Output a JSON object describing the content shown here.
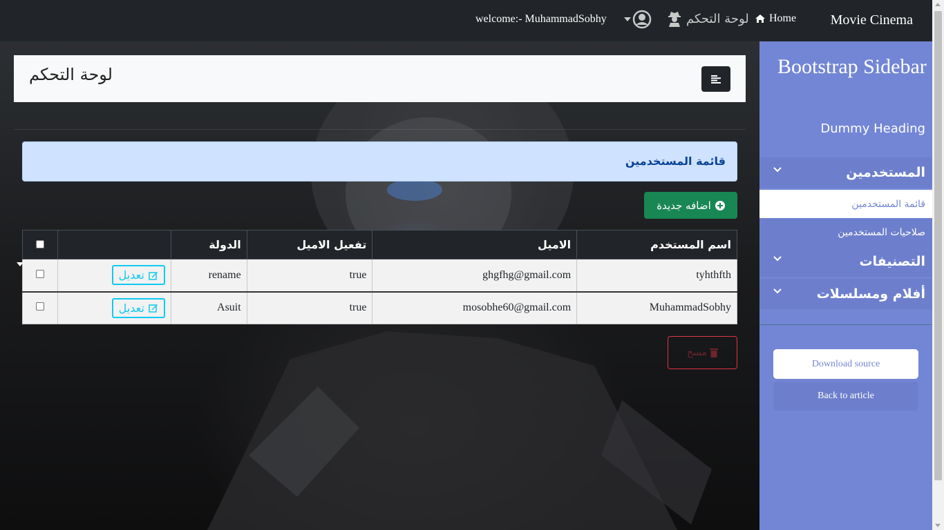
{
  "navbar": {
    "brand": "Movie Cinema",
    "home_label": "Home",
    "dashboard_label": "لوحة التحكم",
    "welcome_text": "welcome:- MuhammadSobhy",
    "icons": {
      "home": "home-icon",
      "dashboard": "user-secret-icon",
      "user": "user-circle-icon",
      "dropdown": "caret-down-icon"
    }
  },
  "page_header": {
    "title": "لوحة التحكم",
    "toggle_icon": "align-left-icon"
  },
  "alert": {
    "text": "قائمة المستخدمين"
  },
  "add_button": {
    "label": "اضافه جديدة",
    "icon": "plus-circle-icon"
  },
  "table": {
    "headers": {
      "username": "اسم المستخدم",
      "email": "الاميل",
      "activation": "تفعيل الاميل",
      "country": "الدولة",
      "actions": ""
    },
    "rows": [
      {
        "username": "tyhthfth",
        "email": "ghgfhg@gmail.com",
        "activation": "true",
        "country": "rename",
        "edit_label": "تعديل"
      },
      {
        "username": "MuhammadSobhy",
        "email": "mosobhe60@gmail.com",
        "activation": "true",
        "country": "Asuit",
        "edit_label": "تعديل"
      }
    ]
  },
  "delete_button": {
    "label": "مسح",
    "icon": "trash-icon"
  },
  "sidebar": {
    "title": "Bootstrap Sidebar",
    "heading": "Dummy Heading",
    "items": [
      {
        "label": "المستخدمين",
        "expanded": true
      },
      {
        "label": "التصنيفات",
        "expanded": false
      },
      {
        "label": "أفلام ومسلسلات",
        "expanded": false
      }
    ],
    "subitems": [
      {
        "label": "قائمة المستخدمين",
        "selected": true
      },
      {
        "label": "صلاحيات المستخدمين",
        "selected": false
      }
    ],
    "download_label": "Download source",
    "back_label": "Back to article"
  },
  "colors": {
    "navbar": "#212529",
    "sidebar": "#7386d5",
    "sidebar_active": "#6d7fcc",
    "alert_bg": "#cfe2ff",
    "success": "#198754",
    "info": "#0dcaf0",
    "danger": "#dc3545"
  }
}
